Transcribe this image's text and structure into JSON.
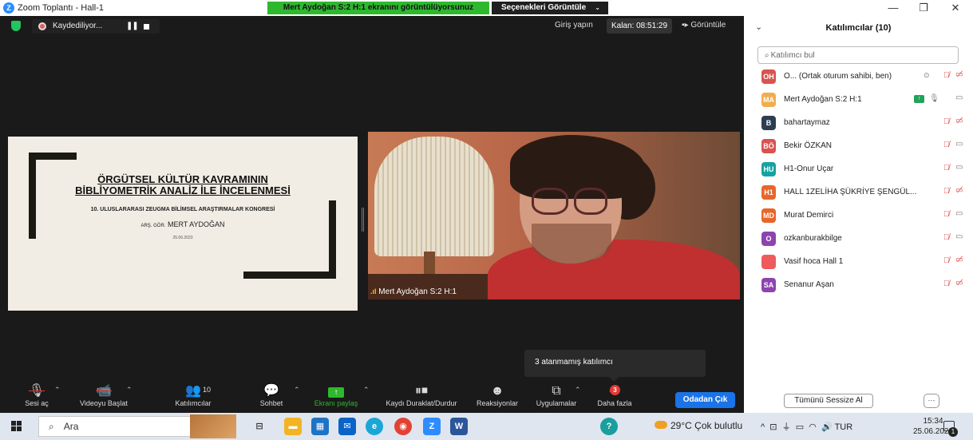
{
  "window": {
    "title": "Zoom Toplantı - Hall-1",
    "share_banner": "Mert Aydoğan S:2 H:1 ekranını görüntülüyorsunuz",
    "view_options": "Seçenekleri Görüntüle",
    "controls": {
      "minimize": "—",
      "restore": "❐",
      "close": "✕"
    }
  },
  "topbar": {
    "recording_label": "Kaydediliyor...",
    "sign_in": "Giriş yapın",
    "remaining": "Kalan: 08:51:29",
    "view": "Görüntüle"
  },
  "slide": {
    "title_line1": "ÖRGÜTSEL KÜLTÜR KAVRAMININ",
    "title_line2": "BİBLİYOMETRİK ANALİZ İLE İNCELENMESİ",
    "congress": "10. ULUSLARARASI ZEUGMA BİLİMSEL ARAŞTIRMALAR KONGRESİ",
    "author_prefix": "ARŞ. GÖR.",
    "author_name": "MERT AYDOĞAN",
    "date": "25.06.2023"
  },
  "video": {
    "participant_label": "Mert Aydoğan S:2 H:1"
  },
  "tooltip": {
    "text": "3 atanmamış katılımcı"
  },
  "toolbar": {
    "audio": "Sesi aç",
    "video": "Videoyu Başlat",
    "participants": "Katılımcılar",
    "participants_count": "10",
    "chat": "Sohbet",
    "share": "Ekranı paylaş",
    "record": "Kaydı Duraklat/Durdur",
    "reactions": "Reaksiyonlar",
    "apps": "Uygulamalar",
    "more": "Daha fazla",
    "more_badge": "3",
    "leave": "Odadan Çık"
  },
  "panel": {
    "title": "Katılımcılar (10)",
    "search_placeholder": "Katılımcı bul",
    "mute_all": "Tümünü Sessize Al",
    "more": "···",
    "participants": [
      {
        "initials": "OH",
        "name": "O... (Ortak oturum sahibi, ben)",
        "color": "#d9534f"
      },
      {
        "initials": "MA",
        "name": "Mert Aydoğan S:2 H:1",
        "color": "#f0ad4e"
      },
      {
        "initials": "B",
        "name": "bahartaymaz",
        "color": "#2c3e50"
      },
      {
        "initials": "BÖ",
        "name": "Bekir ÖZKAN",
        "color": "#d9534f"
      },
      {
        "initials": "HU",
        "name": "H1-Onur Uçar",
        "color": "#17a2a2"
      },
      {
        "initials": "H1",
        "name": "HALL 1ZELİHA ŞÜKRİYE ŞENGÜL...",
        "color": "#e8662a"
      },
      {
        "initials": "MD",
        "name": "Murat Demirci",
        "color": "#e8662a"
      },
      {
        "initials": "O",
        "name": "ozkanburakbilge",
        "color": "#8e44ad"
      },
      {
        "initials": "",
        "name": "Vasif hoca Hall 1",
        "color": "#ef5b5b"
      },
      {
        "initials": "SA",
        "name": "Senanur Aşan",
        "color": "#8e44ad"
      }
    ]
  },
  "taskbar": {
    "search": "Ara",
    "weather": "29°C  Çok bulutlu",
    "lang": "TUR",
    "time": "15:34",
    "date": "25.06.2023",
    "notif_count": "1"
  }
}
